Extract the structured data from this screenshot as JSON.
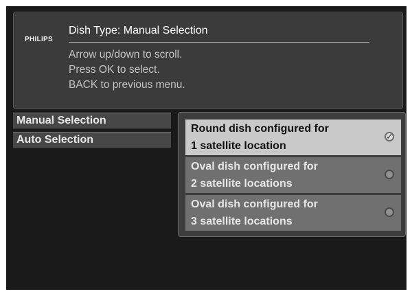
{
  "brand": "PHILIPS",
  "header": {
    "title": "Dish Type: Manual Selection",
    "instructions": [
      "Arrow up/down to scroll.",
      "Press OK to select.",
      "BACK to previous menu."
    ]
  },
  "nav": {
    "items": [
      {
        "label": "Manual Selection"
      },
      {
        "label": "Auto Selection"
      }
    ]
  },
  "options": [
    {
      "line1": "Round dish configured for",
      "line2": "1 satellite location",
      "selected": true,
      "icon": "check-radio-icon"
    },
    {
      "line1": "Oval dish configured for",
      "line2": "2 satellite locations",
      "selected": false,
      "icon": "empty-radio-icon"
    },
    {
      "line1": "Oval dish configured for",
      "line2": "3 satellite locations",
      "selected": false,
      "icon": "empty-radio-icon"
    }
  ],
  "colors": {
    "background": "#1a1a1a",
    "panel": "#3b3b3b",
    "highlight": "#c9c9c9",
    "option": "#707070"
  }
}
